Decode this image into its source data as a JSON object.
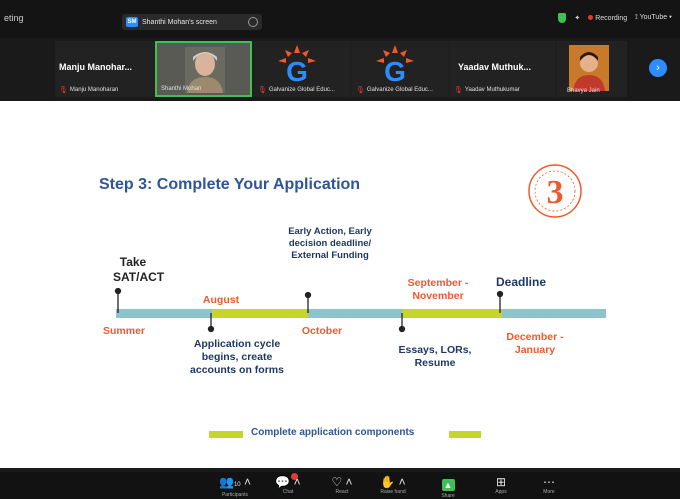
{
  "meeting": {
    "title": "eting"
  },
  "share_pill": {
    "label": "Shanthi Mohan's screen"
  },
  "status": {
    "recording": "Recording",
    "youtube": "YouTube"
  },
  "participants": [
    {
      "name": "Manju Manohar...",
      "caption": "Manju Manoharan",
      "muted": true
    },
    {
      "name": "",
      "caption": "Shanthi Mohan",
      "muted": false,
      "active": true
    },
    {
      "name": "",
      "caption": "Galvanize Global Educ...",
      "muted": true,
      "logo": "G"
    },
    {
      "name": "",
      "caption": "Galvanize Global Educ...",
      "muted": true,
      "logo": "G"
    },
    {
      "name": "Yaadav Muthuk...",
      "caption": "Yaadav Muthukumar",
      "muted": true
    },
    {
      "name": "",
      "caption": "Bhavya Jain",
      "muted": false
    }
  ],
  "slide": {
    "title": "Step 3: Complete Your Application",
    "badge_number": "3",
    "colors": {
      "title": "#2e5597",
      "orange": "#f05a2a",
      "axis": "#8ec3cc",
      "highlight": "#c5d52b"
    },
    "top_labels": {
      "take_test": "Take SAT/ACT",
      "early": "Early Action, Early decision deadline/ External Funding",
      "deadline": "Deadline"
    },
    "month_labels": {
      "summer": "Summer",
      "august": "August",
      "october": "October",
      "september_november": "September - November",
      "december_january": "December - January"
    },
    "bottom_labels": {
      "cycle": "Application cycle begins, create accounts on forms",
      "essays": "Essays, LORs, Resume"
    },
    "legend": "Complete application components"
  },
  "controls": [
    {
      "icon": "participants-icon",
      "glyph": "👥",
      "label": "Participants",
      "count": "10"
    },
    {
      "icon": "chat-icon",
      "glyph": "💬",
      "label": "Chat"
    },
    {
      "icon": "react-icon",
      "glyph": "♡",
      "label": "React"
    },
    {
      "icon": "raise-hand-icon",
      "glyph": "✋",
      "label": "Raise hand"
    },
    {
      "icon": "share-icon",
      "glyph": "▲",
      "label": "Share"
    },
    {
      "icon": "apps-icon",
      "glyph": "⊞",
      "label": "Apps"
    },
    {
      "icon": "more-icon",
      "glyph": "⋯",
      "label": "More"
    }
  ]
}
